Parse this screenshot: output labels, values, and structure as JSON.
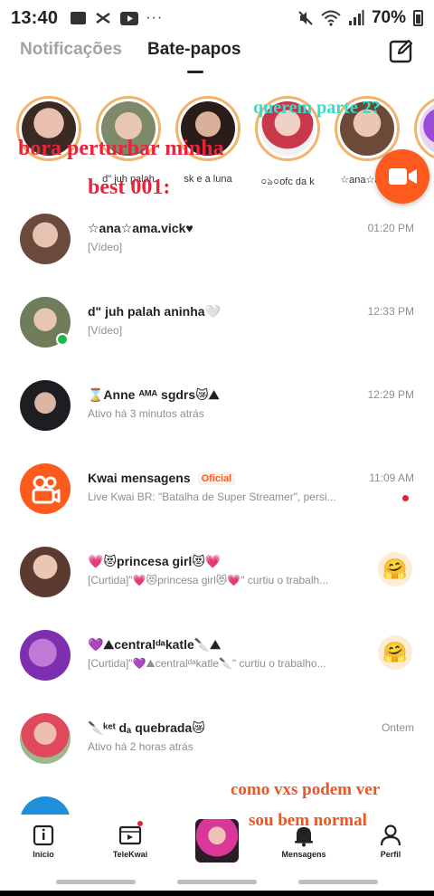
{
  "status_bar": {
    "time": "13:40",
    "icons": [
      "folder-icon",
      "capcut-icon",
      "youtube-icon",
      "more-dots-icon"
    ],
    "battery": "70%",
    "right_icons": [
      "mute-icon",
      "wifi-icon",
      "signal-icon",
      "battery-icon"
    ]
  },
  "header": {
    "tabs": [
      {
        "label": "Notificações",
        "active": false
      },
      {
        "label": "Bate-papos",
        "active": true
      }
    ],
    "compose_icon": "compose-icon"
  },
  "stories": [
    {
      "label": ""
    },
    {
      "label": "d\" juh palah"
    },
    {
      "label": "sk e a luna"
    },
    {
      "label": "০ঌ০ofc da k"
    },
    {
      "label": "☆ana☆ama"
    },
    {
      "label": ""
    }
  ],
  "chats": [
    {
      "name": "☆ana☆ama.vick♥",
      "sub": "[Vídeo]",
      "time": "01:20 PM"
    },
    {
      "name": "d\" juh palah aninha🤍",
      "sub": "[Vídeo]",
      "time": "12:33 PM",
      "online": true
    },
    {
      "name": "⌛Anne ᴬᴹᴬ sgdrs😿⛰",
      "sub": "Ativo há 3 minutos atrás",
      "time": "12:29 PM"
    },
    {
      "name": "Kwai mensagens",
      "badge": "Oficial",
      "sub": "Live Kwai BR: \"Batalha de Super Streamer\", persi...",
      "time": "11:09 AM",
      "unread": true
    },
    {
      "name": "💗😻princesa girl😻💗",
      "sub": "[Curtida]\"💗😻princesa girl😻💗\" curtiu o trabalh...",
      "time": "",
      "emoji": "🤗"
    },
    {
      "name": "💜⛰centralᵈᵃkatle🔪⛰",
      "sub": "[Curtida]\"💜⛰centralᵈᵃkatle🔪\" curtiu o trabalho...",
      "time": "",
      "emoji": "🤗"
    },
    {
      "name": "🔪ᵏᵉᵗ dₐ quebrada😿",
      "sub": "Ativo há 2 horas atrás",
      "time": "Ontem"
    }
  ],
  "overlays": {
    "cyan": "querem parte 2?",
    "red_line1": "bora perturbar minha",
    "red_line2": "best 001:",
    "orange_line1": "como vxs podem ver",
    "orange_line2": "sou bem normal"
  },
  "bottom_nav": [
    {
      "label": "Início",
      "icon": "home-icon"
    },
    {
      "label": "TeleKwai",
      "icon": "tv-icon",
      "dot": true
    },
    {
      "label": "",
      "icon": "profile-thumbnail"
    },
    {
      "label": "Mensagens",
      "icon": "bell-icon",
      "active": true
    },
    {
      "label": "Perfil",
      "icon": "person-icon"
    }
  ],
  "colors": {
    "accent": "#fe5a1d",
    "story_ring": "#f2b36d",
    "online": "#1fb84b",
    "unread": "#e8213b"
  }
}
